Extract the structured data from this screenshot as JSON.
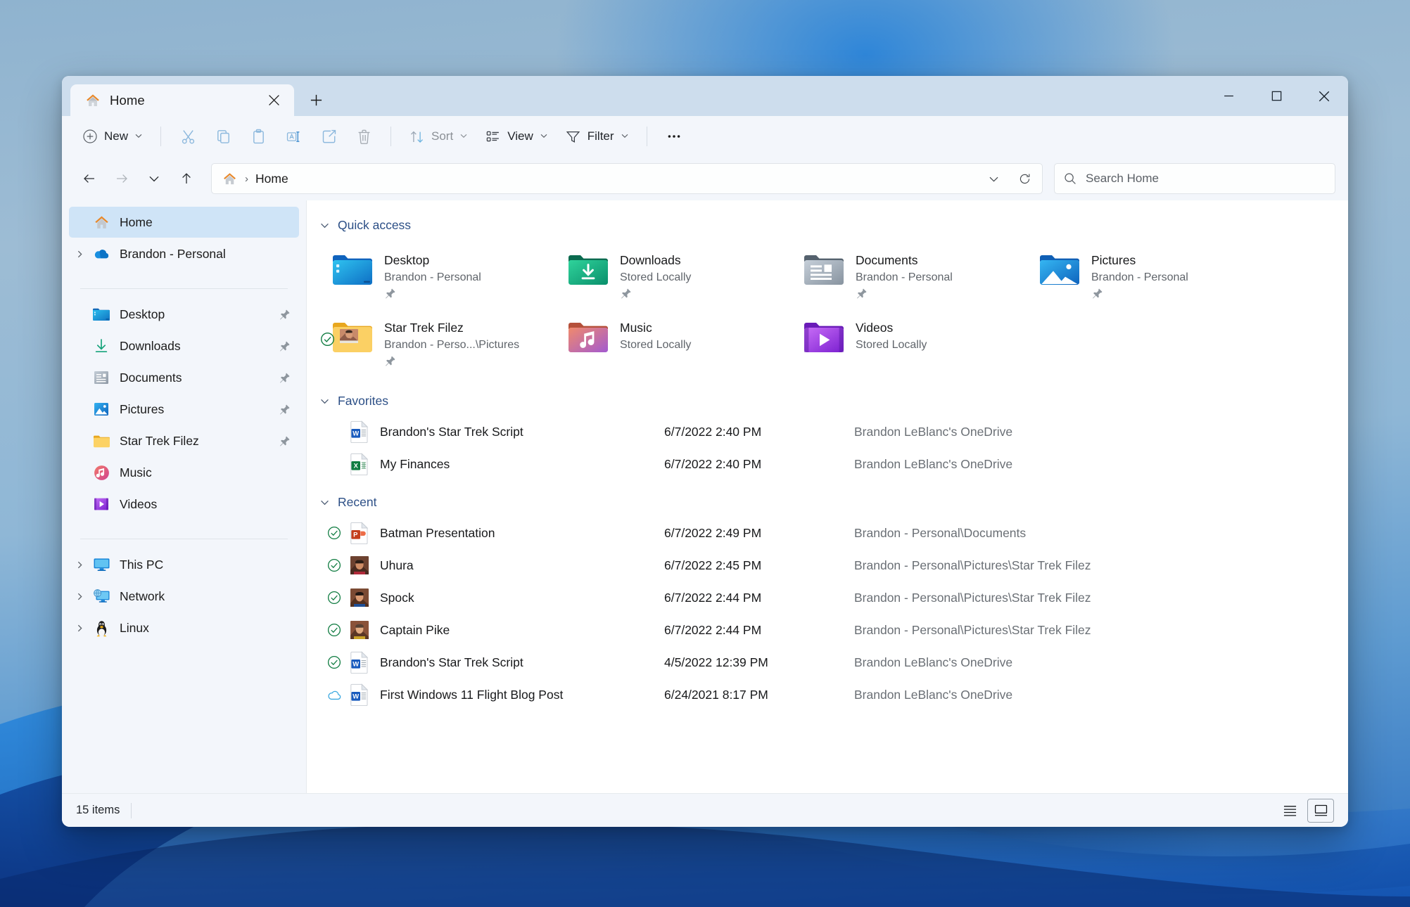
{
  "window": {
    "tab_title": "Home",
    "tab_icon": "home-icon",
    "close_tab_icon": "close-icon",
    "new_tab_icon": "plus-icon",
    "minimize_icon": "minimize-icon",
    "maximize_icon": "maximize-icon",
    "close_icon": "close-icon"
  },
  "toolbar": {
    "new_label": "New",
    "new_icon": "plus-circle-icon",
    "cut_icon": "scissors-icon",
    "copy_icon": "copy-icon",
    "paste_icon": "clipboard-icon",
    "rename_icon": "rename-icon",
    "share_icon": "share-icon",
    "delete_icon": "trash-icon",
    "sort_label": "Sort",
    "sort_icon": "sort-icon",
    "view_label": "View",
    "view_icon": "view-icon",
    "filter_label": "Filter",
    "filter_icon": "funnel-icon",
    "more_icon": "ellipsis-icon"
  },
  "navigation": {
    "back_icon": "arrow-left-icon",
    "forward_icon": "arrow-right-icon",
    "recent_icon": "chevron-down-icon",
    "up_icon": "arrow-up-icon",
    "breadcrumb_home_icon": "home-icon",
    "breadcrumb_label": "Home",
    "breadcrumb_separator": "›",
    "address_dropdown_icon": "chevron-down-icon",
    "refresh_icon": "refresh-icon"
  },
  "search": {
    "placeholder": "Search Home",
    "icon": "search-icon"
  },
  "sidebar": {
    "items": [
      {
        "label": "Home",
        "icon": "home-icon",
        "selected": true,
        "expandable": false,
        "pinned": false
      },
      {
        "label": "Brandon - Personal",
        "icon": "onedrive-icon",
        "selected": false,
        "expandable": true,
        "pinned": false
      },
      {
        "divider": true
      },
      {
        "label": "Desktop",
        "icon": "desktop-folder-icon",
        "selected": false,
        "expandable": false,
        "pinned": true
      },
      {
        "label": "Downloads",
        "icon": "downloads-icon",
        "selected": false,
        "expandable": false,
        "pinned": true
      },
      {
        "label": "Documents",
        "icon": "documents-folder-icon",
        "selected": false,
        "expandable": false,
        "pinned": true
      },
      {
        "label": "Pictures",
        "icon": "pictures-folder-icon",
        "selected": false,
        "expandable": false,
        "pinned": true
      },
      {
        "label": "Star Trek Filez",
        "icon": "folder-icon",
        "selected": false,
        "expandable": false,
        "pinned": true
      },
      {
        "label": "Music",
        "icon": "music-icon",
        "selected": false,
        "expandable": false,
        "pinned": false
      },
      {
        "label": "Videos",
        "icon": "videos-icon",
        "selected": false,
        "expandable": false,
        "pinned": false
      },
      {
        "divider": true
      },
      {
        "label": "This PC",
        "icon": "this-pc-icon",
        "selected": false,
        "expandable": true,
        "pinned": false
      },
      {
        "label": "Network",
        "icon": "network-icon",
        "selected": false,
        "expandable": true,
        "pinned": false
      },
      {
        "label": "Linux",
        "icon": "linux-penguin-icon",
        "selected": false,
        "expandable": true,
        "pinned": false
      }
    ]
  },
  "content": {
    "quick_access": {
      "title": "Quick access",
      "collapse_icon": "chevron-down-icon",
      "tiles": [
        {
          "name": "Desktop",
          "sub": "Brandon - Personal",
          "icon": "desktop-folder-icon",
          "pinned": true,
          "synced": false
        },
        {
          "name": "Downloads",
          "sub": "Stored Locally",
          "icon": "downloads-folder-icon",
          "pinned": true,
          "synced": false
        },
        {
          "name": "Documents",
          "sub": "Brandon - Personal",
          "icon": "documents-folder-icon",
          "pinned": true,
          "synced": false
        },
        {
          "name": "Pictures",
          "sub": "Brandon - Personal",
          "icon": "pictures-folder-icon",
          "pinned": true,
          "synced": false
        },
        {
          "name": "Star Trek Filez",
          "sub": "Brandon - Perso...\\Pictures",
          "icon": "photo-folder-icon",
          "pinned": true,
          "synced": true
        },
        {
          "name": "Music",
          "sub": "Stored Locally",
          "icon": "music-folder-icon",
          "pinned": false,
          "synced": false
        },
        {
          "name": "Videos",
          "sub": "Stored Locally",
          "icon": "videos-folder-icon",
          "pinned": false,
          "synced": false
        }
      ]
    },
    "favorites": {
      "title": "Favorites",
      "collapse_icon": "chevron-down-icon",
      "rows": [
        {
          "name": "Brandon's Star Trek Script",
          "date": "6/7/2022 2:40 PM",
          "path": "Brandon LeBlanc's OneDrive",
          "icon": "word-doc-icon",
          "sync": "none"
        },
        {
          "name": "My Finances",
          "date": "6/7/2022 2:40 PM",
          "path": "Brandon LeBlanc's OneDrive",
          "icon": "excel-doc-icon",
          "sync": "none"
        }
      ]
    },
    "recent": {
      "title": "Recent",
      "collapse_icon": "chevron-down-icon",
      "rows": [
        {
          "name": "Batman Presentation",
          "date": "6/7/2022 2:49 PM",
          "path": "Brandon - Personal\\Documents",
          "icon": "powerpoint-doc-icon",
          "sync": "available"
        },
        {
          "name": "Uhura",
          "date": "6/7/2022 2:45 PM",
          "path": "Brandon - Personal\\Pictures\\Star Trek Filez",
          "icon": "photo-thumb-icon",
          "sync": "available"
        },
        {
          "name": "Spock",
          "date": "6/7/2022 2:44 PM",
          "path": "Brandon - Personal\\Pictures\\Star Trek Filez",
          "icon": "photo-thumb-icon",
          "sync": "available"
        },
        {
          "name": "Captain Pike",
          "date": "6/7/2022 2:44 PM",
          "path": "Brandon - Personal\\Pictures\\Star Trek Filez",
          "icon": "photo-thumb-icon",
          "sync": "available"
        },
        {
          "name": "Brandon's Star Trek Script",
          "date": "4/5/2022 12:39 PM",
          "path": "Brandon LeBlanc's OneDrive",
          "icon": "word-doc-icon",
          "sync": "available"
        },
        {
          "name": "First Windows 11 Flight Blog Post",
          "date": "6/24/2021 8:17 PM",
          "path": "Brandon LeBlanc's OneDrive",
          "icon": "word-doc-icon",
          "sync": "cloud"
        }
      ]
    }
  },
  "statusbar": {
    "item_count": "15 items",
    "list_view_icon": "list-view-icon",
    "details_view_icon": "details-view-icon"
  },
  "colors": {
    "accent": "#0f6cbd",
    "selection": "#cfe4f7",
    "group_header": "#2c4f86",
    "sync_green": "#107c41",
    "cloud_blue": "#0f9bd7"
  }
}
